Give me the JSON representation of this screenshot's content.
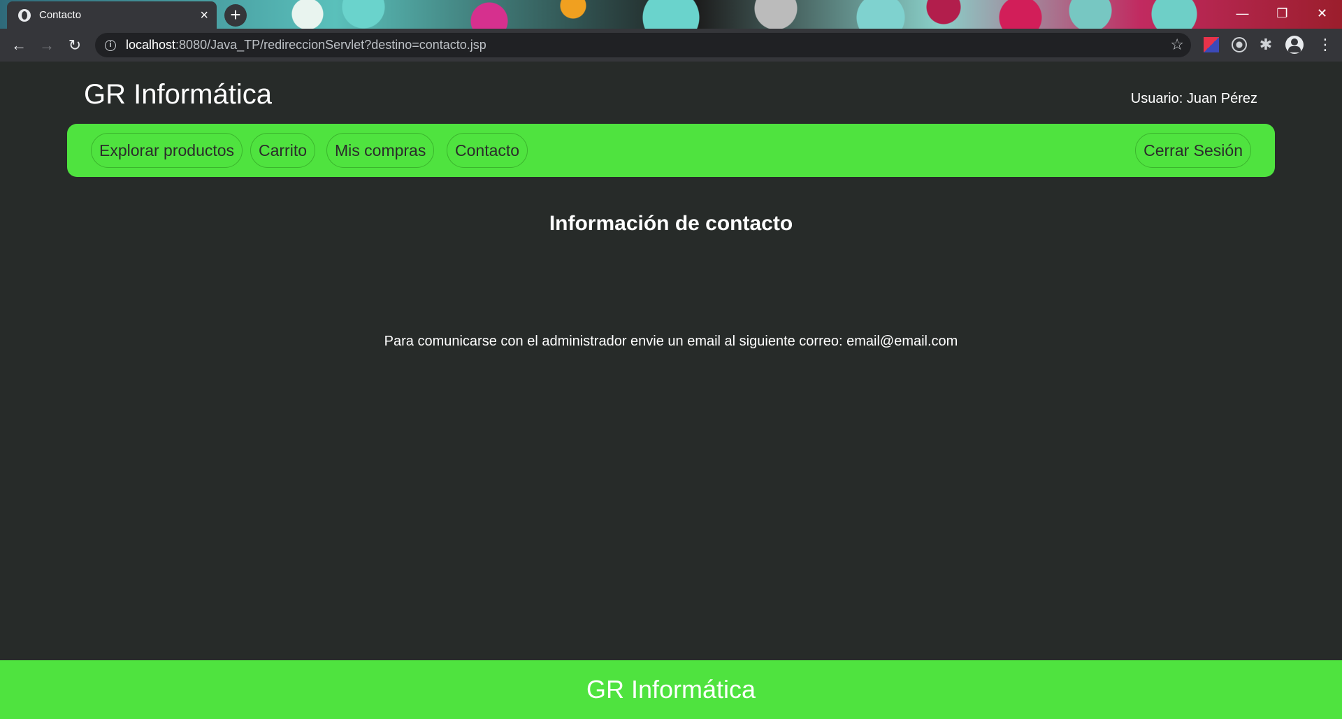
{
  "browser": {
    "tab_title": "Contacto",
    "tab_close": "×",
    "new_tab": "+",
    "url_host": "localhost",
    "url_rest": ":8080/Java_TP/redireccionServlet?destino=contacto.jsp",
    "window_controls": {
      "minimize": "—",
      "restore": "❐",
      "close": "✕"
    },
    "nav": {
      "back": "←",
      "forward": "→",
      "reload": "↻"
    },
    "star": "☆",
    "puzzle": "✱",
    "menu": "⋮",
    "info": "i"
  },
  "header": {
    "site_title": "GR Informática",
    "user_label": "Usuario: Juan Pérez"
  },
  "navbar": {
    "items": [
      {
        "label": "Explorar productos"
      },
      {
        "label": "Carrito"
      },
      {
        "label": "Mis compras"
      },
      {
        "label": "Contacto"
      }
    ],
    "logout": "Cerrar Sesión"
  },
  "main": {
    "heading": "Información de contacto",
    "text": "Para comunicarse con el administrador envie un email al siguiente correo: email@email.com"
  },
  "footer": {
    "title": "GR Informática"
  },
  "colors": {
    "accent_green": "#4fe33f",
    "page_background": "#272b29"
  }
}
